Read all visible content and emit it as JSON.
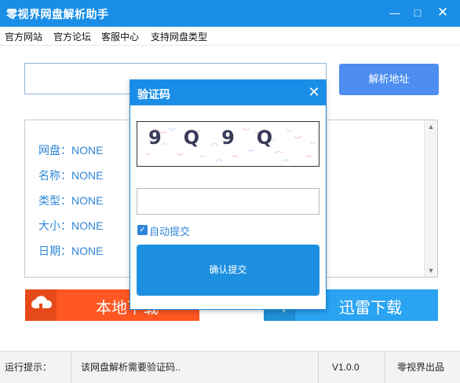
{
  "window": {
    "title": "零视界网盘解析助手"
  },
  "menu": {
    "items": [
      "官方网站",
      "官方论坛",
      "客服中心",
      "支持网盘类型"
    ]
  },
  "url_input": {
    "value": "",
    "placeholder": ""
  },
  "parse_button": {
    "label": "解析地址"
  },
  "info": {
    "rows": [
      {
        "label": "网盘：",
        "value": "NONE"
      },
      {
        "label": "名称：",
        "value": "NONE"
      },
      {
        "label": "类型：",
        "value": "NONE"
      },
      {
        "label": "大小：",
        "value": "NONE"
      },
      {
        "label": "日期：",
        "value": "NONE"
      }
    ]
  },
  "buttons": {
    "local_download": "本地下载",
    "thunder_download": "迅雷下载"
  },
  "status": {
    "label": "运行提示：",
    "message": "该网盘解析需要验证码..",
    "version": "V1.0.0",
    "brand": "零视界出品"
  },
  "dialog": {
    "title": "验证码",
    "captcha_text": "9Q9Q",
    "code_value": "",
    "auto_submit_label": "自动提交",
    "auto_submit_checked": true,
    "confirm_label": "确认提交"
  },
  "colors": {
    "titlebar": "#1a8ee6",
    "accent_text": "#2f86d6",
    "parse_button": "#4d8ef0",
    "local_download": "#ff5722",
    "thunder_download": "#29a3f2",
    "status_bar": "#f3f3f3"
  }
}
